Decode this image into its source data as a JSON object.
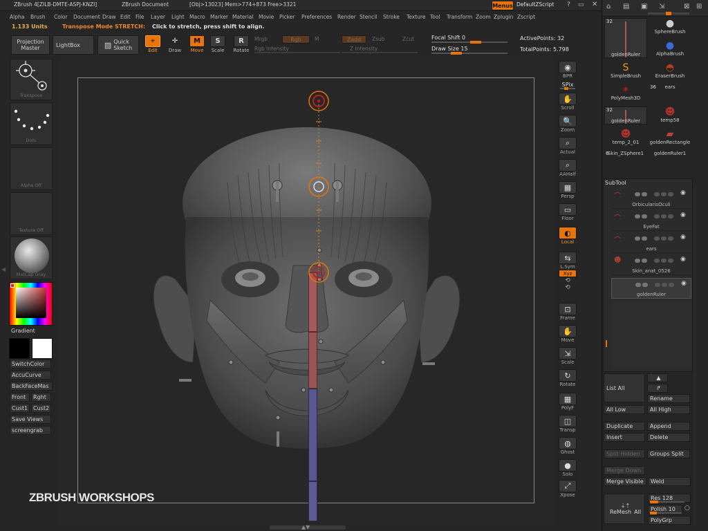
{
  "titlebar": {
    "app": "ZBrush 4[ZILB-DMTE-ASPJ-KNZI]",
    "document": "ZBrush Document",
    "stats": "[Obj>13023] Mem>774+873 Free>3321",
    "menus_button": "Menus",
    "script_button": "DefaultZScript"
  },
  "menubar": [
    "Alpha",
    "Brush",
    "Color",
    "Document",
    "Draw",
    "Edit",
    "File",
    "Layer",
    "Light",
    "Macro",
    "Marker",
    "Material",
    "Movie",
    "Picker",
    "Preferences",
    "Render",
    "Stencil",
    "Stroke",
    "Texture",
    "Tool",
    "Transform",
    "Zoom",
    "Zplugin",
    "Zscript"
  ],
  "statusline": {
    "units": "1.133 Units",
    "mode": "Transpose Mode STRETCH:",
    "hint": "Click to stretch, press shift to align."
  },
  "toolbar": {
    "projection_master": [
      "Projection",
      "Master"
    ],
    "lightbox": "LightBox",
    "quick_sketch": [
      "Quick",
      "Sketch"
    ],
    "edit": "Edit",
    "draw": "Draw",
    "move": "Move",
    "scale": "Scale",
    "rotate": "Rotate",
    "mrgb": "Mrgb",
    "rgb": "Rgb",
    "m": "M",
    "zadd": "Zadd",
    "zsub": "Zsub",
    "zcut": "Zcut",
    "rgb_intensity": "Rgb Intensity",
    "z_intensity": "Z Intensity",
    "focal_shift_label": "Focal Shift",
    "focal_shift_value": "0",
    "draw_size_label": "Draw Size",
    "draw_size_value": "15",
    "active_points": "ActivePoints: 32",
    "total_points": "TotalPoints: 5.798"
  },
  "left_shelf": {
    "transpose": "Transpose",
    "dots": "Dots",
    "alpha": "Alpha Off",
    "texture": "Texture Off",
    "material": "MatCap Gray",
    "gradient": "Gradient",
    "buttons": [
      "SwitchColor",
      "AccuCurve",
      "BackFaceMas",
      "Front",
      "Rght",
      "Cust1",
      "Cust2",
      "Save Views",
      "screengrab"
    ]
  },
  "right_shelf": [
    "BPR",
    "SPix",
    "Scroll",
    "Zoom",
    "Actual",
    "AAHalf",
    "Persp",
    "Floor",
    "Local",
    "L.Sym",
    "Xyz",
    "Frame",
    "Move",
    "Scale",
    "Rotate",
    "PolyF",
    "Transp",
    "Ghost",
    "Solo",
    "Xpose"
  ],
  "tool_palette": {
    "thumbs": [
      {
        "name": "goldenRuler",
        "count": "32"
      },
      {
        "name": "SphereBrush",
        "count": ""
      },
      {
        "name": "AlphaBrush",
        "count": ""
      },
      {
        "name": "SimpleBrush",
        "count": ""
      },
      {
        "name": "EraserBrush",
        "count": ""
      },
      {
        "name": "PolyMesh3D",
        "count": ""
      },
      {
        "name": "ears",
        "count": "36"
      },
      {
        "name": "goldenRuler",
        "count": "32"
      },
      {
        "name": "temp58",
        "count": ""
      },
      {
        "name": "temp_2_01",
        "count": ""
      },
      {
        "name": "goldenRectangle",
        "count": ""
      },
      {
        "name": "Skin_ZSphere1",
        "count": "6"
      },
      {
        "name": "goldenRuler1",
        "count": ""
      }
    ],
    "subtool_header": "SubTool",
    "subtools": [
      "OrbicularisOculi",
      "EyeFat",
      "ears",
      "Skin_anat_0526",
      "goldenRuler"
    ],
    "list_all": "List All",
    "rename": "Rename",
    "all_low": "All Low",
    "all_high": "All High",
    "duplicate": "Duplicate",
    "append": "Append",
    "insert": "Insert",
    "delete": "Delete",
    "split_hidden": "Split Hidden",
    "groups_split": "Groups Split",
    "merge_down": "Merge Down",
    "merge_visible": "Merge Visible",
    "weld": "Weld",
    "remesh_all": [
      "ReMesh",
      "All"
    ],
    "res": "Res 128",
    "polish": "Polish 10",
    "polygrp": "PolyGrp"
  },
  "watermark": "ZBRUSH WORKSHOPS",
  "colors": {
    "accent": "#e8740a",
    "ruler_red": "#a35a5a",
    "ruler_blue": "#58588e",
    "bg": "#262626"
  }
}
